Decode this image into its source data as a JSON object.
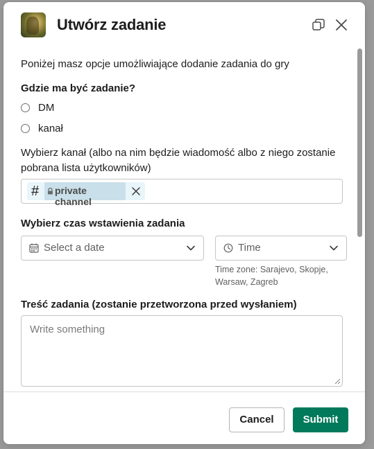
{
  "modal": {
    "title": "Utwórz zadanie",
    "intro": "Poniżej masz opcje umożliwiające dodanie zadania do gry"
  },
  "location": {
    "label": "Gdzie ma być zadanie?",
    "options": [
      "DM",
      "kanał"
    ]
  },
  "channel": {
    "label_line1": "Wybierz kanał (albo na nim będzie wiadomość albo z niego zostanie",
    "label_line2": "pobrana lista użytkowników)",
    "selected": "private channel"
  },
  "schedule": {
    "label": "Wybierz czas wstawienia zadania",
    "date_placeholder": "Select a date",
    "time_placeholder": "Time",
    "timezone_line1": "Time zone: Sarajevo, Skopje,",
    "timezone_line2": "Warsaw, Zagreb"
  },
  "content": {
    "label": "Treść zadania (zostanie przetworzona przed wysłaniem)",
    "placeholder": "Write something"
  },
  "footer": {
    "cancel_label": "Cancel",
    "submit_label": "Submit"
  },
  "colors": {
    "submit": "#007a5a",
    "chip_background": "#e8f5fa"
  },
  "icons": {
    "expand": "open-in-window-icon",
    "close": "close-icon",
    "calendar": "calendar-icon",
    "clock": "clock-icon",
    "lock": "lock-icon",
    "hash": "hash-icon"
  }
}
